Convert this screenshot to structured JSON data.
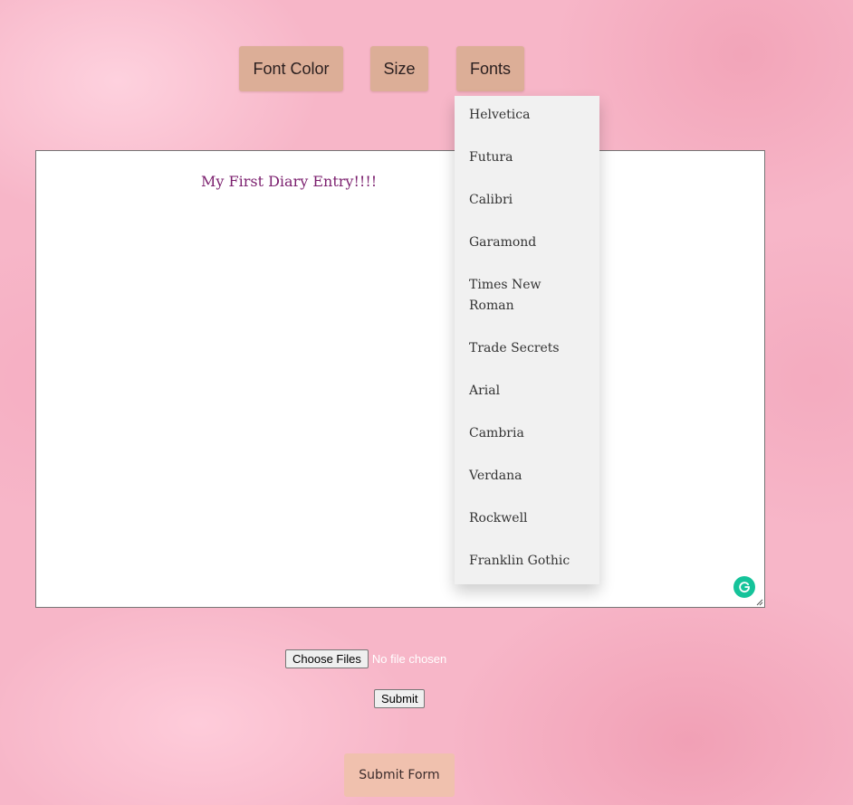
{
  "toolbar": {
    "font_color_label": "Font Color",
    "size_label": "Size",
    "fonts_label": "Fonts"
  },
  "editor": {
    "text": "My First Diary Entry!!!!",
    "text_color": "#7b1f6e"
  },
  "fonts_dropdown": {
    "items": [
      "Helvetica",
      "Futura",
      "Calibri",
      "Garamond",
      "Times New Roman",
      "Trade Secrets",
      "Arial",
      "Cambria",
      "Verdana",
      "Rockwell",
      "Franklin Gothic"
    ]
  },
  "file_input": {
    "button_label": "Choose Files",
    "status": "No file chosen"
  },
  "submit_label": "Submit",
  "submit_form_label": "Submit Form",
  "icons": {
    "assistant": "grammarly-icon"
  },
  "colors": {
    "toolbar_button": "#dcae97",
    "submit_form_button": "#f0c1ae",
    "dropdown_bg": "#f1f1f1",
    "grammarly": "#15c39a"
  }
}
